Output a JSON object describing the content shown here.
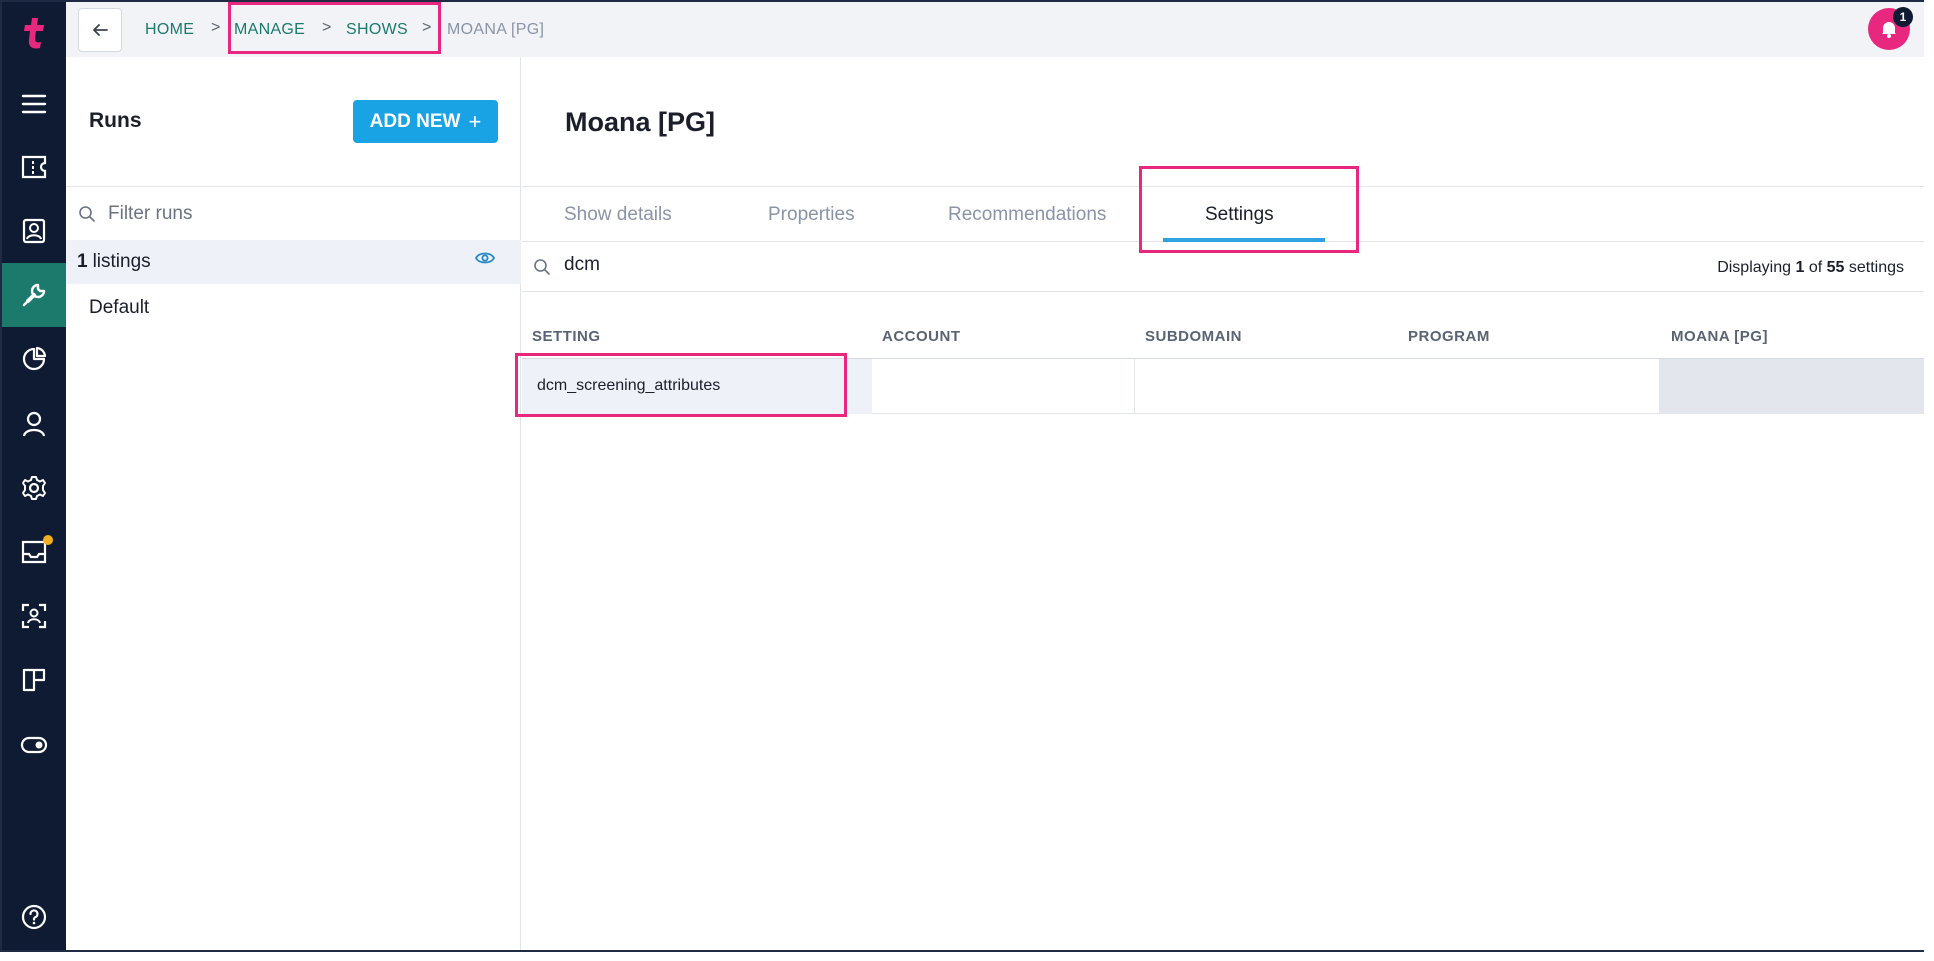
{
  "breadcrumb": {
    "items": [
      "HOME",
      "MANAGE",
      "SHOWS",
      "MOANA [PG]"
    ],
    "separator": ">"
  },
  "notifications": {
    "count": "1"
  },
  "runs": {
    "title": "Runs",
    "add_button": "ADD NEW",
    "add_icon": "+",
    "filter_placeholder": "Filter runs",
    "listings_count": "1",
    "listings_label": "listings",
    "default_label": "Default"
  },
  "main": {
    "title": "Moana [PG]",
    "tabs": [
      {
        "label": "Show details",
        "active": false
      },
      {
        "label": "Properties",
        "active": false
      },
      {
        "label": "Recommendations",
        "active": false
      },
      {
        "label": "Settings",
        "active": true
      }
    ],
    "search_value": "dcm",
    "display": {
      "prefix": "Displaying",
      "shown": "1",
      "of": "of",
      "total": "55",
      "suffix": "settings"
    },
    "table": {
      "columns": [
        "SETTING",
        "ACCOUNT",
        "SUBDOMAIN",
        "PROGRAM",
        "MOANA [PG]"
      ],
      "rows": [
        {
          "setting": "dcm_screening_attributes"
        }
      ]
    }
  },
  "colors": {
    "rail": "#0f1b33",
    "active_rail": "#1b7a6b",
    "accent": "#19a3e5",
    "highlight": "#e8277f",
    "link": "#1b7a6b"
  }
}
